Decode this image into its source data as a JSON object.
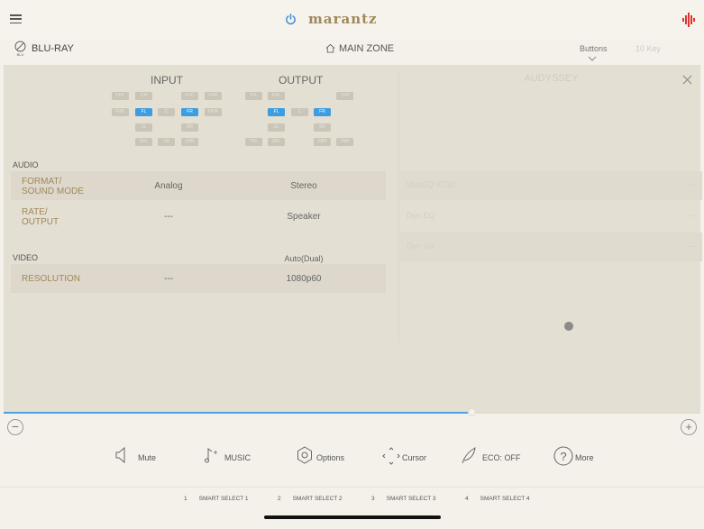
{
  "header": {
    "brand": "marantz",
    "source_label": "BLU-RAY",
    "source_badge": "BLU",
    "zone_label": "MAIN ZONE",
    "tabs": [
      {
        "label": "Buttons",
        "active": true
      },
      {
        "label": "10 Key",
        "active": false
      }
    ]
  },
  "signal": {
    "input_title": "INPUT",
    "output_title": "OUTPUT",
    "input_channels": [
      {
        "label": "FHL",
        "on": false
      },
      {
        "label": "CH",
        "on": false
      },
      {
        "label": "FHC",
        "on": false
      },
      {
        "label": "FHR",
        "on": false
      },
      {
        "label": "FWL",
        "on": false
      },
      {
        "label": "FL",
        "on": true
      },
      {
        "label": "C",
        "on": false
      },
      {
        "label": "FR",
        "on": true
      },
      {
        "label": "FWR",
        "on": false
      },
      {
        "label": "SL",
        "on": false
      },
      {
        "label": "SR",
        "on": false
      },
      {
        "label": "SHL",
        "on": false
      },
      {
        "label": "SB",
        "on": false
      },
      {
        "label": "SHR",
        "on": false
      }
    ],
    "output_channels": [
      {
        "label": "TFL",
        "on": false
      },
      {
        "label": "FHL",
        "on": false
      },
      {
        "label": "TFR",
        "on": false
      },
      {
        "label": "FL",
        "on": true
      },
      {
        "label": "C",
        "on": false
      },
      {
        "label": "FR",
        "on": true
      },
      {
        "label": "SL",
        "on": false
      },
      {
        "label": "SR",
        "on": false
      },
      {
        "label": "TRL",
        "on": false
      },
      {
        "label": "SBL",
        "on": false
      },
      {
        "label": "SBR",
        "on": false
      },
      {
        "label": "TRR",
        "on": false
      }
    ]
  },
  "audio": {
    "section_label": "AUDIO",
    "rows": [
      {
        "label": "FORMAT/\nSOUND MODE",
        "input": "Analog",
        "output": "Stereo"
      },
      {
        "label": "RATE/\nOUTPUT",
        "input": "---",
        "output": "Speaker"
      }
    ]
  },
  "video": {
    "section_label": "VIDEO",
    "output_mode": "Auto(Dual)",
    "rows": [
      {
        "label": "RESOLUTION",
        "input": "---",
        "output": "1080p60"
      }
    ]
  },
  "audyssey": {
    "title": "AUDYSSEY",
    "rows": [
      {
        "label": "MultEQ XT32",
        "value": "---"
      },
      {
        "label": "Dyn EQ",
        "value": "---"
      },
      {
        "label": "Dyn Vol",
        "value": "---"
      }
    ]
  },
  "volume": {
    "level_fraction": 0.672,
    "minus": "−",
    "plus": "+"
  },
  "controls": [
    {
      "name": "mute",
      "label": "Mute",
      "icon": "speaker-icon"
    },
    {
      "name": "music",
      "label": "MUSIC",
      "icon": "music-note-icon"
    },
    {
      "name": "options",
      "label": "Options",
      "icon": "gear-icon"
    },
    {
      "name": "cursor",
      "label": "Cursor",
      "icon": "cursor-icon"
    },
    {
      "name": "eco",
      "label": "ECO: OFF",
      "icon": "leaf-icon"
    },
    {
      "name": "more",
      "label": "More",
      "icon": "question-icon",
      "glyph": "?"
    }
  ],
  "smart_select": [
    {
      "number": "1",
      "label": "SMART SELECT 1"
    },
    {
      "number": "2",
      "label": "SMART SELECT 2"
    },
    {
      "number": "3",
      "label": "SMART SELECT 3"
    },
    {
      "number": "4",
      "label": "SMART SELECT 4"
    }
  ],
  "colors": {
    "accent_gold": "#a0875a",
    "active_channel": "#3d9de0",
    "volume_fill": "#4aa3e6"
  }
}
